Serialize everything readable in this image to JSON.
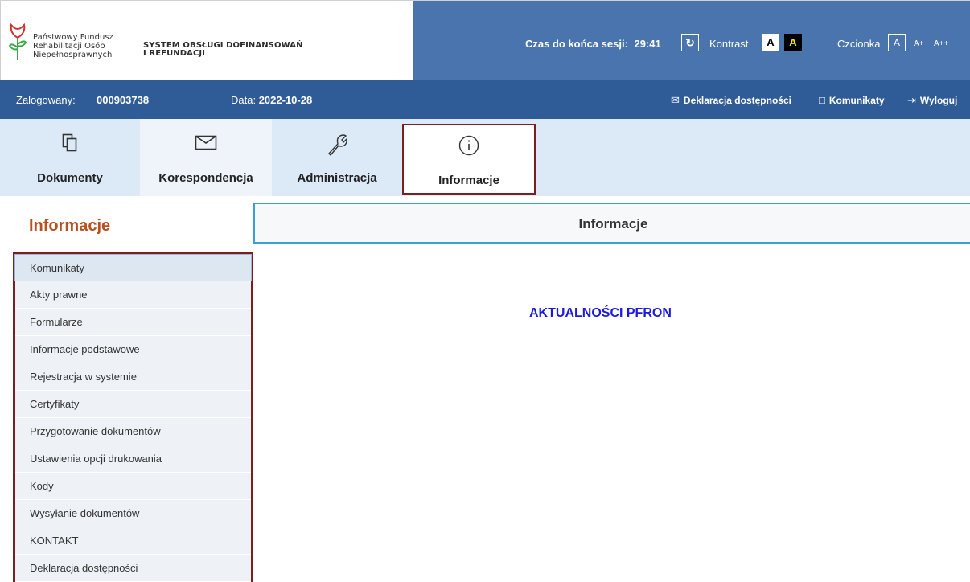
{
  "brand": {
    "logo_lines": [
      "Państwowy Fundusz",
      "Rehabilitacji Osób",
      "Niepełnosprawnych"
    ],
    "system_lines": [
      "SYSTEM OBSŁUGI DOFINANSOWAŃ",
      "I REFUNDACJI"
    ]
  },
  "header": {
    "session_label": "Czas do końca sesji:",
    "session_time": "29:41",
    "refresh_icon": "refresh-icon",
    "contrast_label": "Kontrast",
    "contrast_white": "A",
    "contrast_black": "A",
    "font_label": "Czcionka",
    "font_normal": "A",
    "font_large": "A+",
    "font_xlarge": "A++"
  },
  "infobar": {
    "logged_label": "Zalogowany:",
    "logged_id": "000903738",
    "date_label": "Data:",
    "date_value": "2022-10-28",
    "declaration_link": "Deklaracja dostępności",
    "messages_link": "Komunikaty",
    "logout_link": "Wyloguj"
  },
  "tabs": [
    {
      "label": "Dokumenty",
      "icon": "documents-icon"
    },
    {
      "label": "Korespondencja",
      "icon": "envelope-icon"
    },
    {
      "label": "Administracja",
      "icon": "wrench-icon"
    },
    {
      "label": "Informacje",
      "icon": "info-icon",
      "selected": true
    }
  ],
  "sidebar": {
    "heading": "Informacje",
    "items": [
      {
        "label": "Komunikaty",
        "active": true
      },
      {
        "label": "Akty prawne"
      },
      {
        "label": "Formularze"
      },
      {
        "label": "Informacje podstawowe"
      },
      {
        "label": "Rejestracja w systemie"
      },
      {
        "label": "Certyfikaty"
      },
      {
        "label": "Przygotowanie dokumentów"
      },
      {
        "label": "Ustawienia opcji drukowania"
      },
      {
        "label": "Kody"
      },
      {
        "label": "Wysyłanie dokumentów"
      },
      {
        "label": "KONTAKT"
      },
      {
        "label": "Deklaracja dostępności"
      }
    ]
  },
  "main": {
    "heading": "Informacje",
    "link": "AKTUALNOŚCI PFRON"
  },
  "colors": {
    "header_blue": "#4a74ad",
    "infobar_blue": "#2f5b97",
    "tab_bar": "#dce9f6",
    "highlight_frame": "#7a1e1e",
    "side_heading": "#b8501f",
    "link": "#1a1ae0"
  }
}
